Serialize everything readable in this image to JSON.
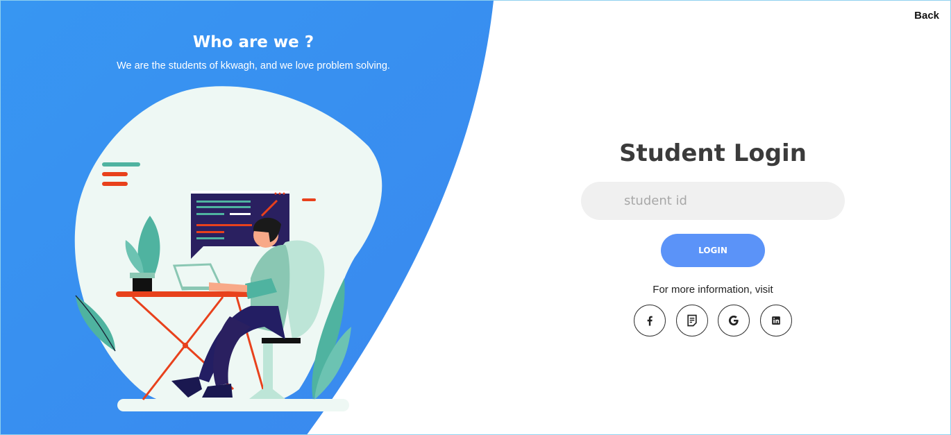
{
  "hero": {
    "title": "Who are we ?",
    "subtitle": "We are the students of kkwagh, and we love problem solving."
  },
  "nav": {
    "back_label": "Back"
  },
  "login": {
    "title": "Student Login",
    "id_placeholder": "student id",
    "button_label": "LOGIN",
    "info_text": "For more information, visit"
  },
  "socials": [
    {
      "icon": "facebook-icon"
    },
    {
      "icon": "document-icon"
    },
    {
      "icon": "google-icon"
    },
    {
      "icon": "linkedin-icon"
    }
  ],
  "colors": {
    "panel_blue": "#3a8ff0",
    "button_blue": "#5b93f8",
    "input_bg": "#f0f0f0",
    "accent_red": "#e8411c",
    "accent_teal": "#4fb3a0"
  }
}
